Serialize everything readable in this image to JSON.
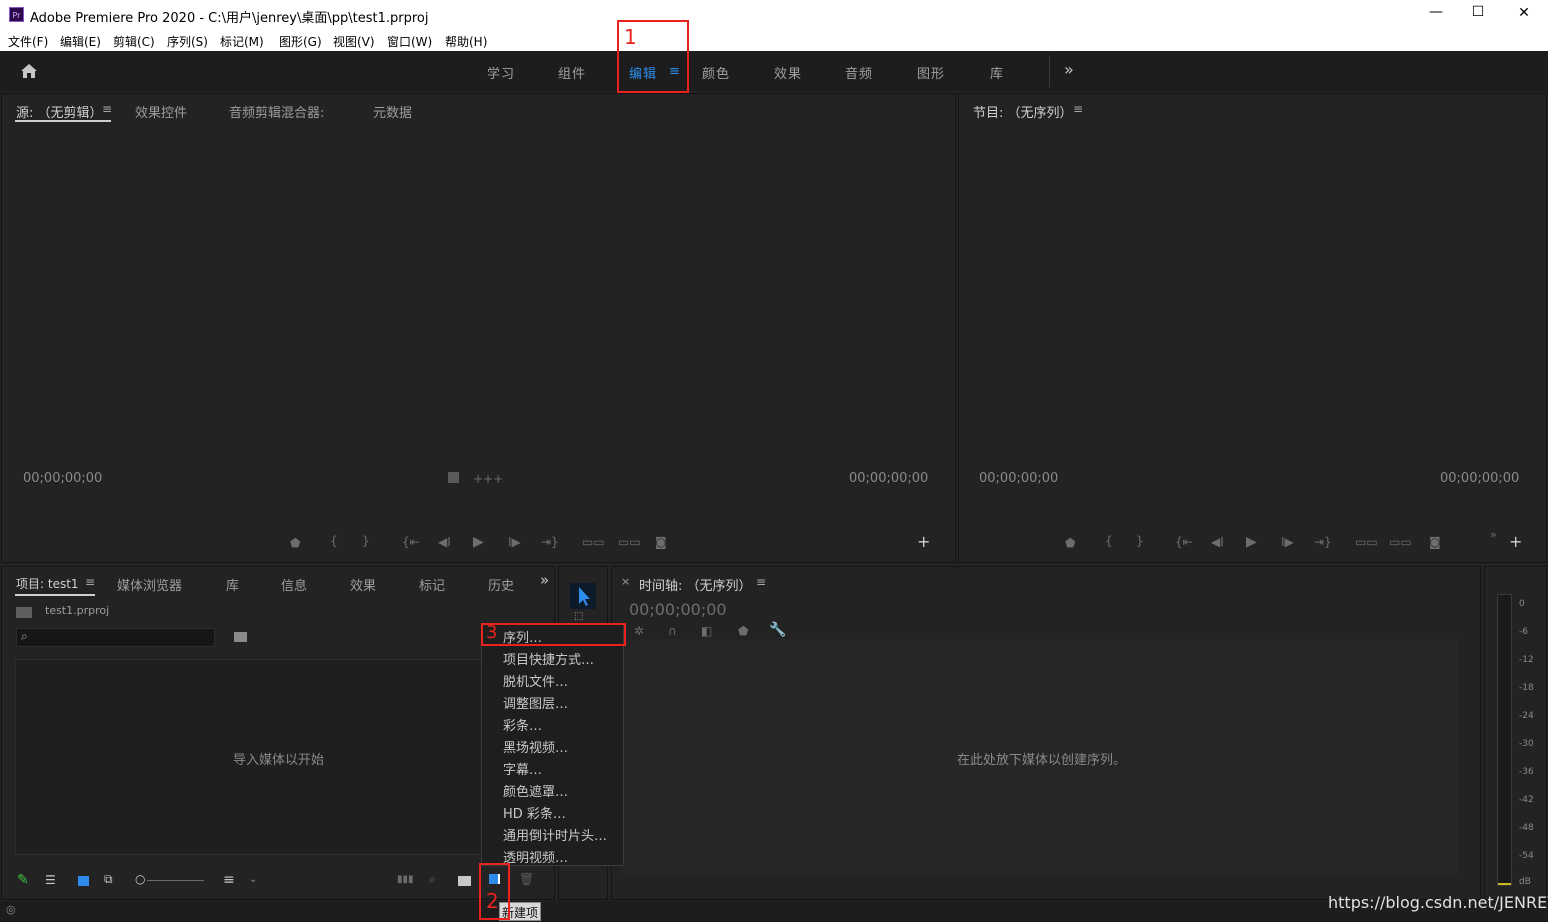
{
  "window": {
    "app_icon": "Pr",
    "title": "Adobe Premiere Pro 2020 - C:\\用户\\jenrey\\桌面\\pp\\test1.prproj",
    "minimize": "—",
    "maximize": "☐",
    "close": "✕"
  },
  "menu": [
    "文件(F)",
    "编辑(E)",
    "剪辑(C)",
    "序列(S)",
    "标记(M)",
    "图形(G)",
    "视图(V)",
    "窗口(W)",
    "帮助(H)"
  ],
  "workspaces": {
    "tabs": [
      "学习",
      "组件",
      "编辑",
      "颜色",
      "效果",
      "音频",
      "图形",
      "库"
    ],
    "active": "编辑",
    "overflow": "»"
  },
  "source_panel": {
    "tabs": [
      "源: （无剪辑）",
      "效果控件",
      "音频剪辑混合器:",
      "元数据"
    ],
    "timecode_left": "00;00;00;00",
    "timecode_right": "00;00;00;00"
  },
  "program_panel": {
    "tab": "节目: （无序列）",
    "timecode_left": "00;00;00;00",
    "timecode_right": "00;00;00;00"
  },
  "project_panel": {
    "tabs": [
      "项目: test1",
      "媒体浏览器",
      "库",
      "信息",
      "效果",
      "标记",
      "历史"
    ],
    "file": "test1.prproj",
    "search_placeholder": "",
    "empty_hint": "导入媒体以开始"
  },
  "timeline_panel": {
    "tab": "时间轴: （无序列）",
    "close": "×",
    "timecode": "00;00;00;00",
    "empty_hint": "在此处放下媒体以创建序列。"
  },
  "context_menu": {
    "items": [
      "序列…",
      "项目快捷方式…",
      "脱机文件…",
      "调整图层…",
      "彩条…",
      "黑场视频…",
      "字幕…",
      "颜色遮罩…",
      "HD 彩条…",
      "通用倒计时片头…",
      "透明视频…"
    ]
  },
  "tooltip": "新建项",
  "annotations": [
    "1",
    "2",
    "3"
  ],
  "audio_meter": {
    "scale": [
      "0",
      "-6",
      "-12",
      "-18",
      "-24",
      "-30",
      "-36",
      "-42",
      "-48",
      "-54",
      "dB"
    ]
  },
  "watermark": "https://blog.csdn.net/JENREY",
  "colors": {
    "accent_blue": "#2d8ceb",
    "annotation_red": "#e8231d",
    "panel_bg": "#232323"
  }
}
